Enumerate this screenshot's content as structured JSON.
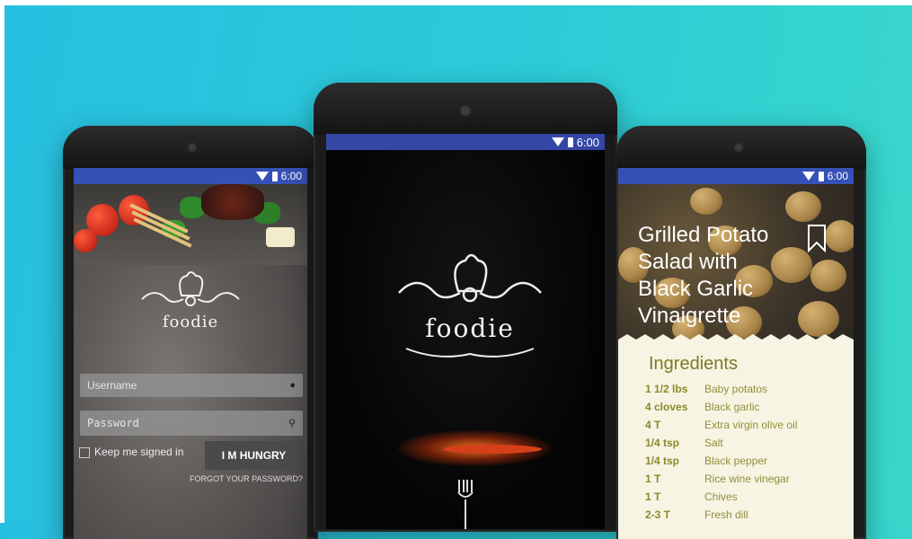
{
  "status_time": "6:00",
  "colors": {
    "background_left": "#27bfe0",
    "background_right": "#3ad8c9",
    "status_bar": "#3651b5",
    "button": "#4a4a4a",
    "accent_olive": "#7a7a24"
  },
  "login_screen": {
    "username_placeholder": "Username",
    "password_placeholder": "Password",
    "keep_signed_in_label": "Keep me signed in",
    "submit_label": "I M HUNGRY",
    "forgot_password_label": "FORGOT YOUR PASSWORD?",
    "logo_text": "foodie"
  },
  "splash_screen": {
    "logo_text": "foodie"
  },
  "recipe_screen": {
    "title": "Grilled Potato Salad with Black Garlic Vinaigrette",
    "ingredients_heading": "Ingredients",
    "ingredients": [
      {
        "qty": "1 1/2 lbs",
        "name": "Baby potatos"
      },
      {
        "qty": "4 cloves",
        "name": "Black garlic"
      },
      {
        "qty": "4 T",
        "name": "Extra virgin olive oil"
      },
      {
        "qty": "1/4 tsp",
        "name": "Salt"
      },
      {
        "qty": "1/4 tsp",
        "name": "Black pepper"
      },
      {
        "qty": "1 T",
        "name": "Rice wine vinegar"
      },
      {
        "qty": "1 T",
        "name": "Chives"
      },
      {
        "qty": "2-3 T",
        "name": "Fresh dill"
      }
    ]
  }
}
